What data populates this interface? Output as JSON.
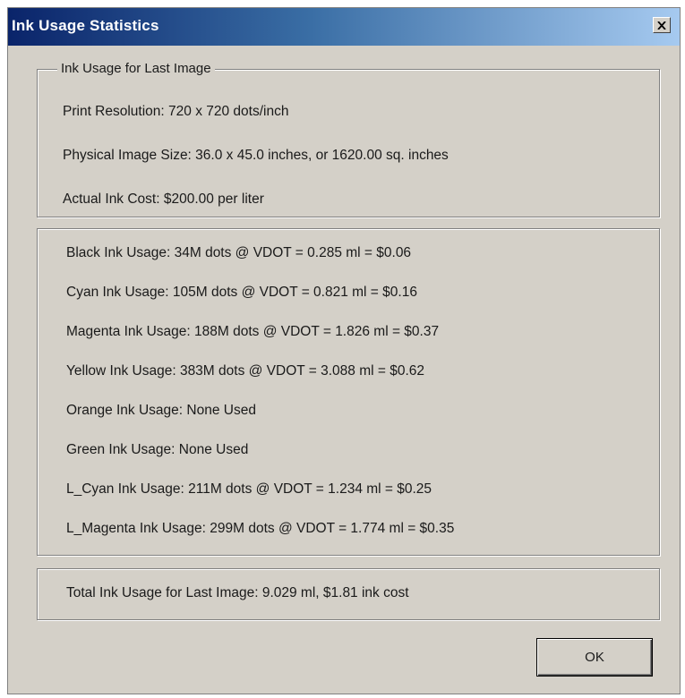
{
  "window": {
    "title": "Ink Usage Statistics"
  },
  "last_image_group": {
    "legend": "Ink Usage for Last Image",
    "print_resolution": "Print Resolution: 720 x 720 dots/inch",
    "physical_size": "Physical Image Size: 36.0 x 45.0 inches, or 1620.00 sq. inches",
    "ink_cost": "Actual Ink Cost: $200.00 per liter"
  },
  "ink_usage": [
    "Black Ink Usage: 34M dots @ VDOT = 0.285 ml = $0.06",
    "Cyan Ink Usage: 105M dots @ VDOT = 0.821 ml = $0.16",
    "Magenta Ink Usage: 188M dots @ VDOT = 1.826 ml = $0.37",
    "Yellow Ink Usage: 383M dots @ VDOT = 3.088 ml = $0.62",
    "Orange Ink Usage: None Used",
    "Green Ink Usage: None Used",
    "L_Cyan Ink Usage: 211M dots @ VDOT = 1.234 ml = $0.25",
    "L_Magenta Ink Usage: 299M dots @ VDOT = 1.774 ml = $0.35"
  ],
  "total": "Total Ink Usage for Last Image: 9.029 ml, $1.81 ink cost",
  "buttons": {
    "ok_label": "OK"
  },
  "colors": {
    "title_bar_start": "#0a246a",
    "title_bar_end": "#a6caf0",
    "dialog_face": "#d4d0c8"
  },
  "icons": {
    "close": "close-icon"
  }
}
